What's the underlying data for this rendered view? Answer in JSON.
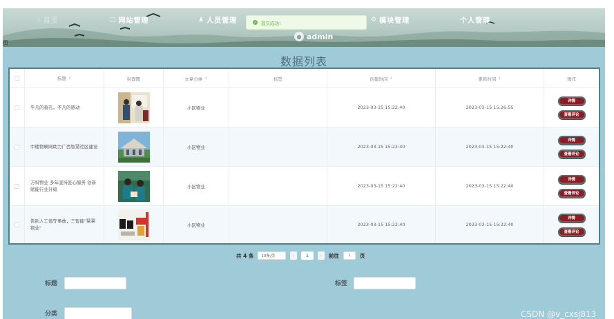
{
  "header": {
    "nav": [
      {
        "label": "首页",
        "icon": "home-icon"
      },
      {
        "label": "网站管理",
        "icon": "grid-icon"
      },
      {
        "label": "人员管理",
        "icon": "person-icon"
      },
      {
        "label": "模块管理",
        "icon": "gear-icon"
      },
      {
        "label": "个人管理",
        "icon": ""
      }
    ],
    "toast": "提交成功!",
    "user": "admin",
    "side_glyph": "页"
  },
  "list_title": "数据列表",
  "table": {
    "columns": [
      "标题",
      "封面图",
      "文章分类",
      "标签",
      "创建时间",
      "更新时间",
      "操作"
    ],
    "rows": [
      {
        "title": "平凡的善孔，不凡的感动",
        "category": "小区物业",
        "tag": "",
        "created": "2023-03-15 15:22:40",
        "updated": "2023-03-15 15:26:55"
      },
      {
        "title": "中楼物联网助力广西智慧社区建设",
        "category": "小区物业",
        "tag": "",
        "created": "2023-03-15 15:22:40",
        "updated": "2023-03-15 15:22:40"
      },
      {
        "title": "万科物业 多年坚持匠心服务 创新赋能行业升级",
        "category": "小区物业",
        "tag": "",
        "created": "2023-03-15 15:22:40",
        "updated": "2023-03-15 15:22:40"
      },
      {
        "title": "告别人工值守事故，三智能\"慧慧物业\"",
        "category": "小区物业",
        "tag": "",
        "created": "2023-03-15 15:22:40",
        "updated": "2023-03-15 15:22:40"
      }
    ],
    "actions": {
      "detail": "详情",
      "comments": "查看评论"
    }
  },
  "pagination": {
    "total_text": "共 4 条",
    "page_size": "10条/页",
    "current_page": "1",
    "goto_label": "前往",
    "goto_value": "1",
    "page_unit": "页",
    "prev_icon": "chevron-left-icon",
    "next_icon": "chevron-right-icon"
  },
  "form": {
    "title_label": "标题",
    "tag_label": "标签",
    "third_label": "分类"
  },
  "watermark": "CSDN @v_cxsj813"
}
